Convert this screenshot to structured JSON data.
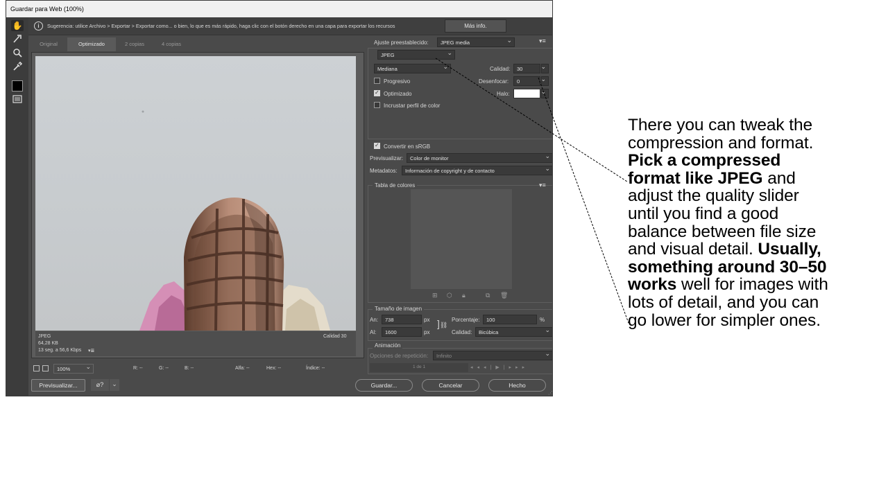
{
  "window": {
    "title": "Guardar para Web (100%)"
  },
  "tools": [
    {
      "icon": "hand-icon"
    },
    {
      "icon": "slice-select-icon"
    },
    {
      "icon": "zoom-icon"
    },
    {
      "icon": "eyedropper-icon"
    },
    {
      "icon": "eyedropper-color-swatch"
    },
    {
      "icon": "slice-visibility-icon"
    }
  ],
  "hint": {
    "text": "Sugerencia: utilice Archivo > Exportar > Exportar como... o bien, lo que es más rápido, haga clic con el botón derecho en una capa para exportar los recursos",
    "more_info": "Más info."
  },
  "tabs": [
    "Original",
    "Optimizado",
    "2 copias",
    "4 copias"
  ],
  "active_tab": "Optimizado",
  "preview": {
    "format": "JPEG",
    "size": "64,28 KB",
    "time": "13 seg. a 56,6 Kbps",
    "time_menu": "▾≣",
    "quality": "Calidad 30"
  },
  "status": {
    "zoom": "100%",
    "r": "R: --",
    "g": "G: --",
    "b": "B: --",
    "alpha": "Alfa: --",
    "hex": "Hex: --",
    "index": "Índice: --"
  },
  "settings": {
    "preset_label": "Ajuste preestablecido:",
    "preset_value": "JPEG media",
    "format": "JPEG",
    "compression": "Mediana",
    "quality_label": "Calidad:",
    "quality_value": "30",
    "blur_label": "Desenfocar:",
    "blur_value": "0",
    "matte_label": "Halo:",
    "progressive_label": "Progresivo",
    "progressive": false,
    "optimized_label": "Optimizado",
    "optimized": true,
    "embed_profile_label": "Incrustar perfil de color",
    "embed_profile": false,
    "srgb_label": "Convertir en sRGB",
    "srgb": true,
    "preview_label": "Previsualizar:",
    "preview_value": "Color de monitor",
    "metadata_label": "Metadatos:",
    "metadata_value": "Información de copyright y de contacto"
  },
  "color_table": {
    "title": "Tabla de colores"
  },
  "image_size": {
    "title": "Tamaño de imagen",
    "width_label": "An:",
    "width_value": "738",
    "height_label": "Al:",
    "height_value": "1600",
    "unit": "px",
    "percent_label": "Porcentaje:",
    "percent_value": "100",
    "percent_unit": "%",
    "quality_label": "Calidad:",
    "quality_value": "Bicúbica"
  },
  "animation": {
    "title": "Animación",
    "repeat_label": "Opciones de repetición:",
    "repeat_value": "Infinito",
    "frame_counter": "1 de 1"
  },
  "buttons": {
    "preview": "Previsualizar...",
    "save": "Guardar...",
    "cancel": "Cancelar",
    "done": "Hecho"
  },
  "callout": {
    "p1": "There you can tweak the compression and format. ",
    "b1": "Pick a compressed format like JPEG",
    "p2": " and adjust the quality slider until you find a good balance between file size and visual detail. ",
    "b2": "Usually, something around 30–50 works",
    "p3": " well for images with lots of detail, and you can go lower for simpler ones."
  },
  "colors": {
    "dialog_bg": "#4a4a4a",
    "panel_line": "#5e5e5e",
    "text": "#d6d6d6"
  }
}
